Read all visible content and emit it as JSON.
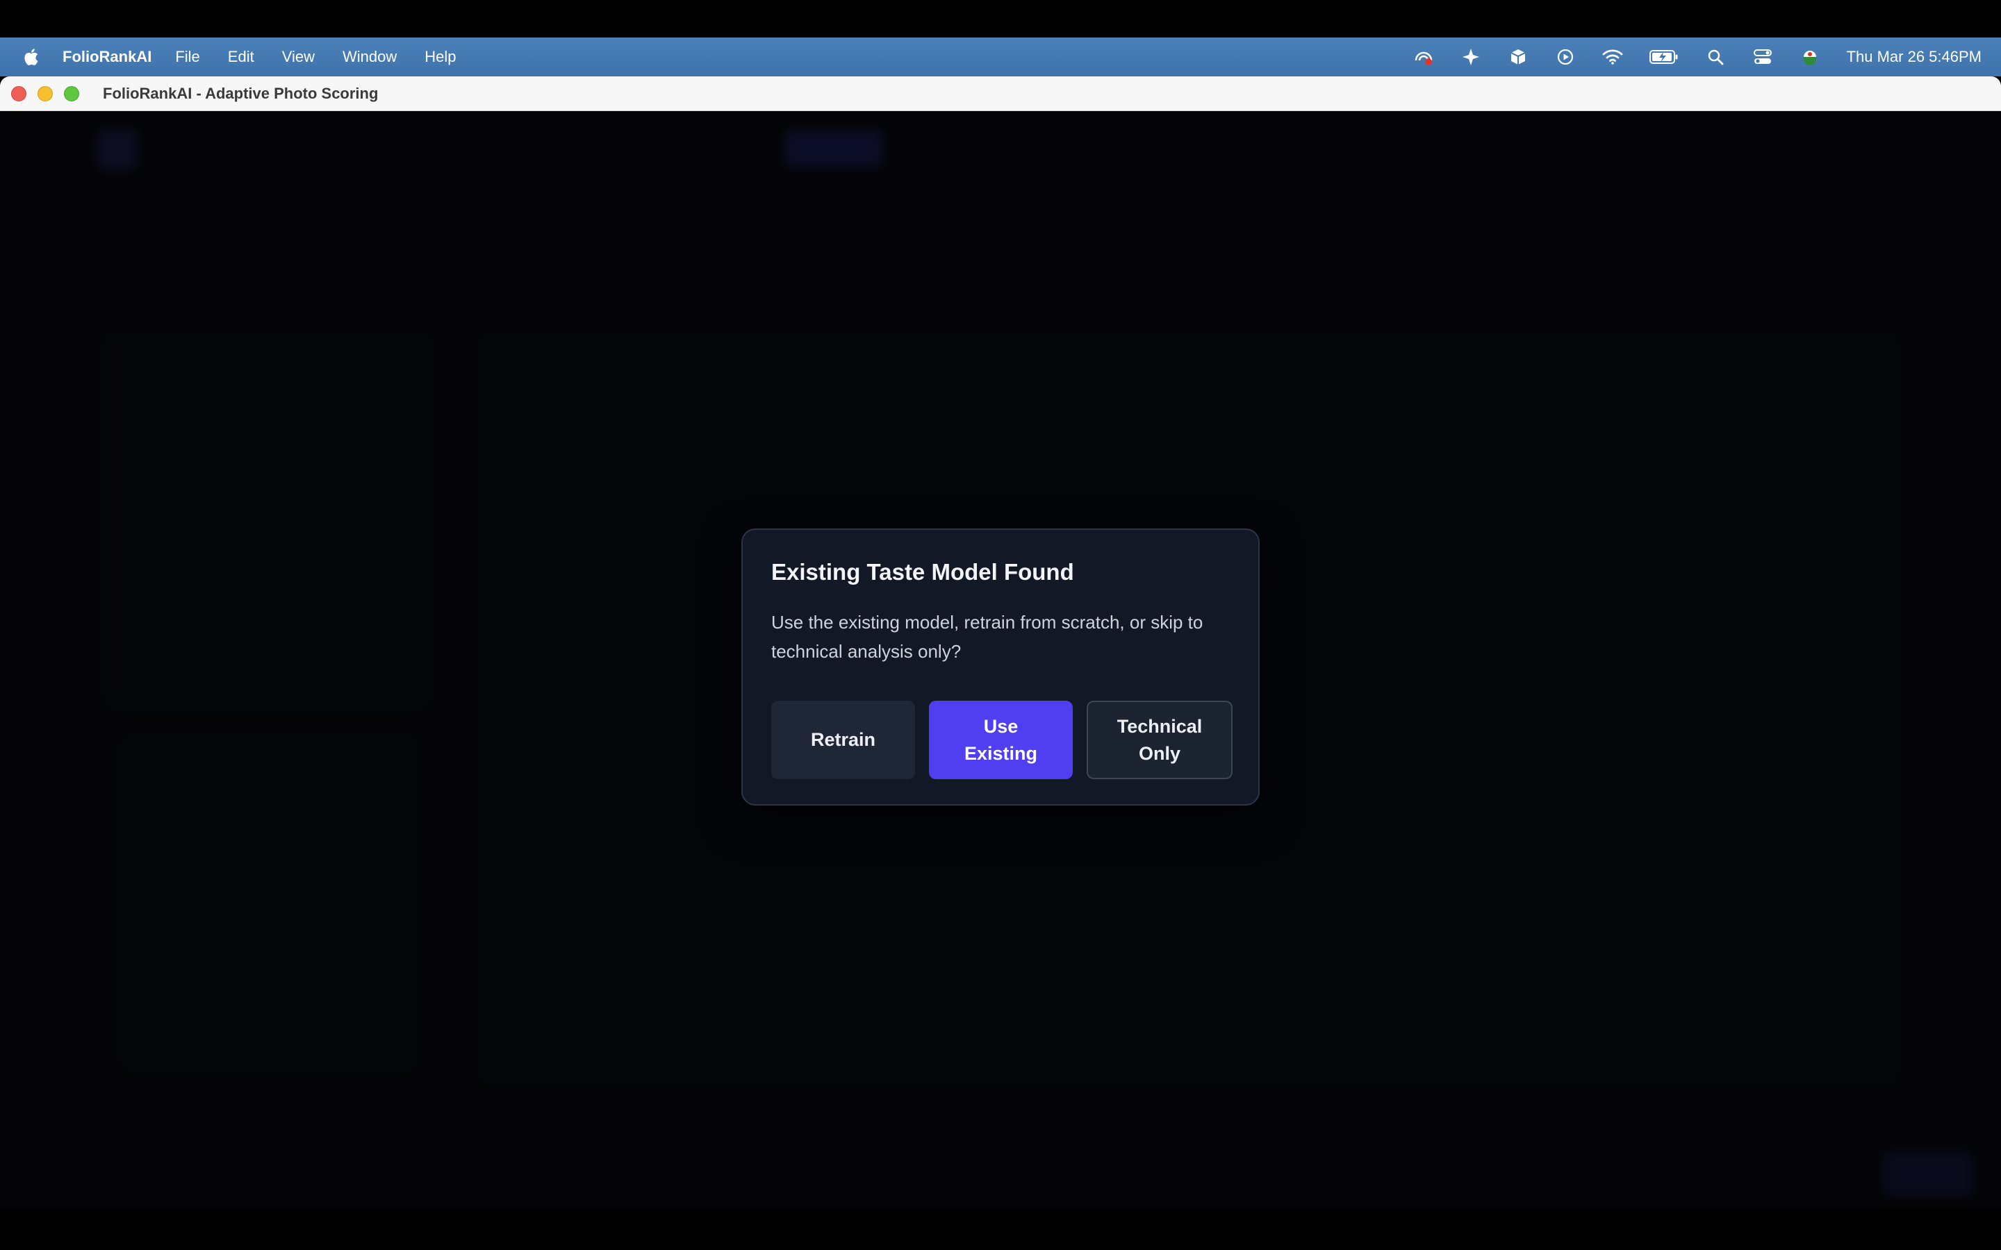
{
  "menubar": {
    "app_name": "FolioRankAI",
    "items": [
      "File",
      "Edit",
      "View",
      "Window",
      "Help"
    ],
    "status_icons": [
      "screen-record-icon",
      "sparkle-icon",
      "cube-icon",
      "play-circle-icon",
      "wifi-icon",
      "battery-icon",
      "search-icon",
      "control-center-icon",
      "user-flag-icon"
    ],
    "clock": "Thu Mar 26  5:46PM"
  },
  "window": {
    "title": "FolioRankAI - Adaptive Photo Scoring"
  },
  "dialog": {
    "title": "Existing Taste Model Found",
    "message": "Use the existing model, retrain from scratch, or skip to technical analysis only?",
    "buttons": {
      "retrain": "Retrain",
      "use_existing": "Use Existing",
      "technical_only": "Technical Only"
    }
  },
  "colors": {
    "menubar": "#4279b1",
    "primary_button": "#4f3ff0",
    "dialog_bg": "#121826",
    "secondary_button": "#1f2736"
  }
}
